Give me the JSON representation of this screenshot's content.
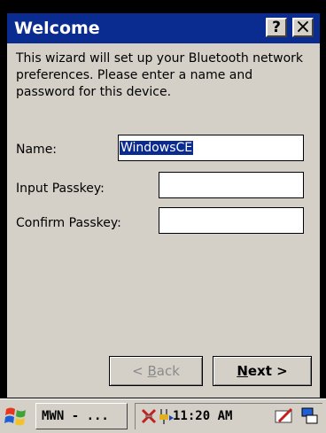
{
  "window": {
    "title": "Welcome",
    "help_label": "?",
    "close_label": "×"
  },
  "description": "This wizard will set up your Bluetooth network preferences. Please enter a name and password for this device.",
  "form": {
    "name_label": "Name:",
    "name_value": "WindowsCE",
    "input_passkey_label": "Input Passkey:",
    "input_passkey_value": "",
    "confirm_passkey_label": "Confirm Passkey:",
    "confirm_passkey_value": ""
  },
  "buttons": {
    "back_prefix": "< ",
    "back_mnemonic": "B",
    "back_rest": "ack",
    "next_mnemonic": "N",
    "next_rest": "ext >"
  },
  "taskbar": {
    "task_label": "MWN - ...",
    "clock": "11:20 AM"
  },
  "icons": {
    "start": "windows-flag-icon",
    "tray": [
      "bluetooth-icon",
      "power-plug-icon",
      "input-panel-icon",
      "desktop-icon"
    ]
  },
  "colors": {
    "titlebar": "#0a2b8f",
    "selection": "#0a2b8f",
    "dialog_face": "#d4d0c8"
  }
}
